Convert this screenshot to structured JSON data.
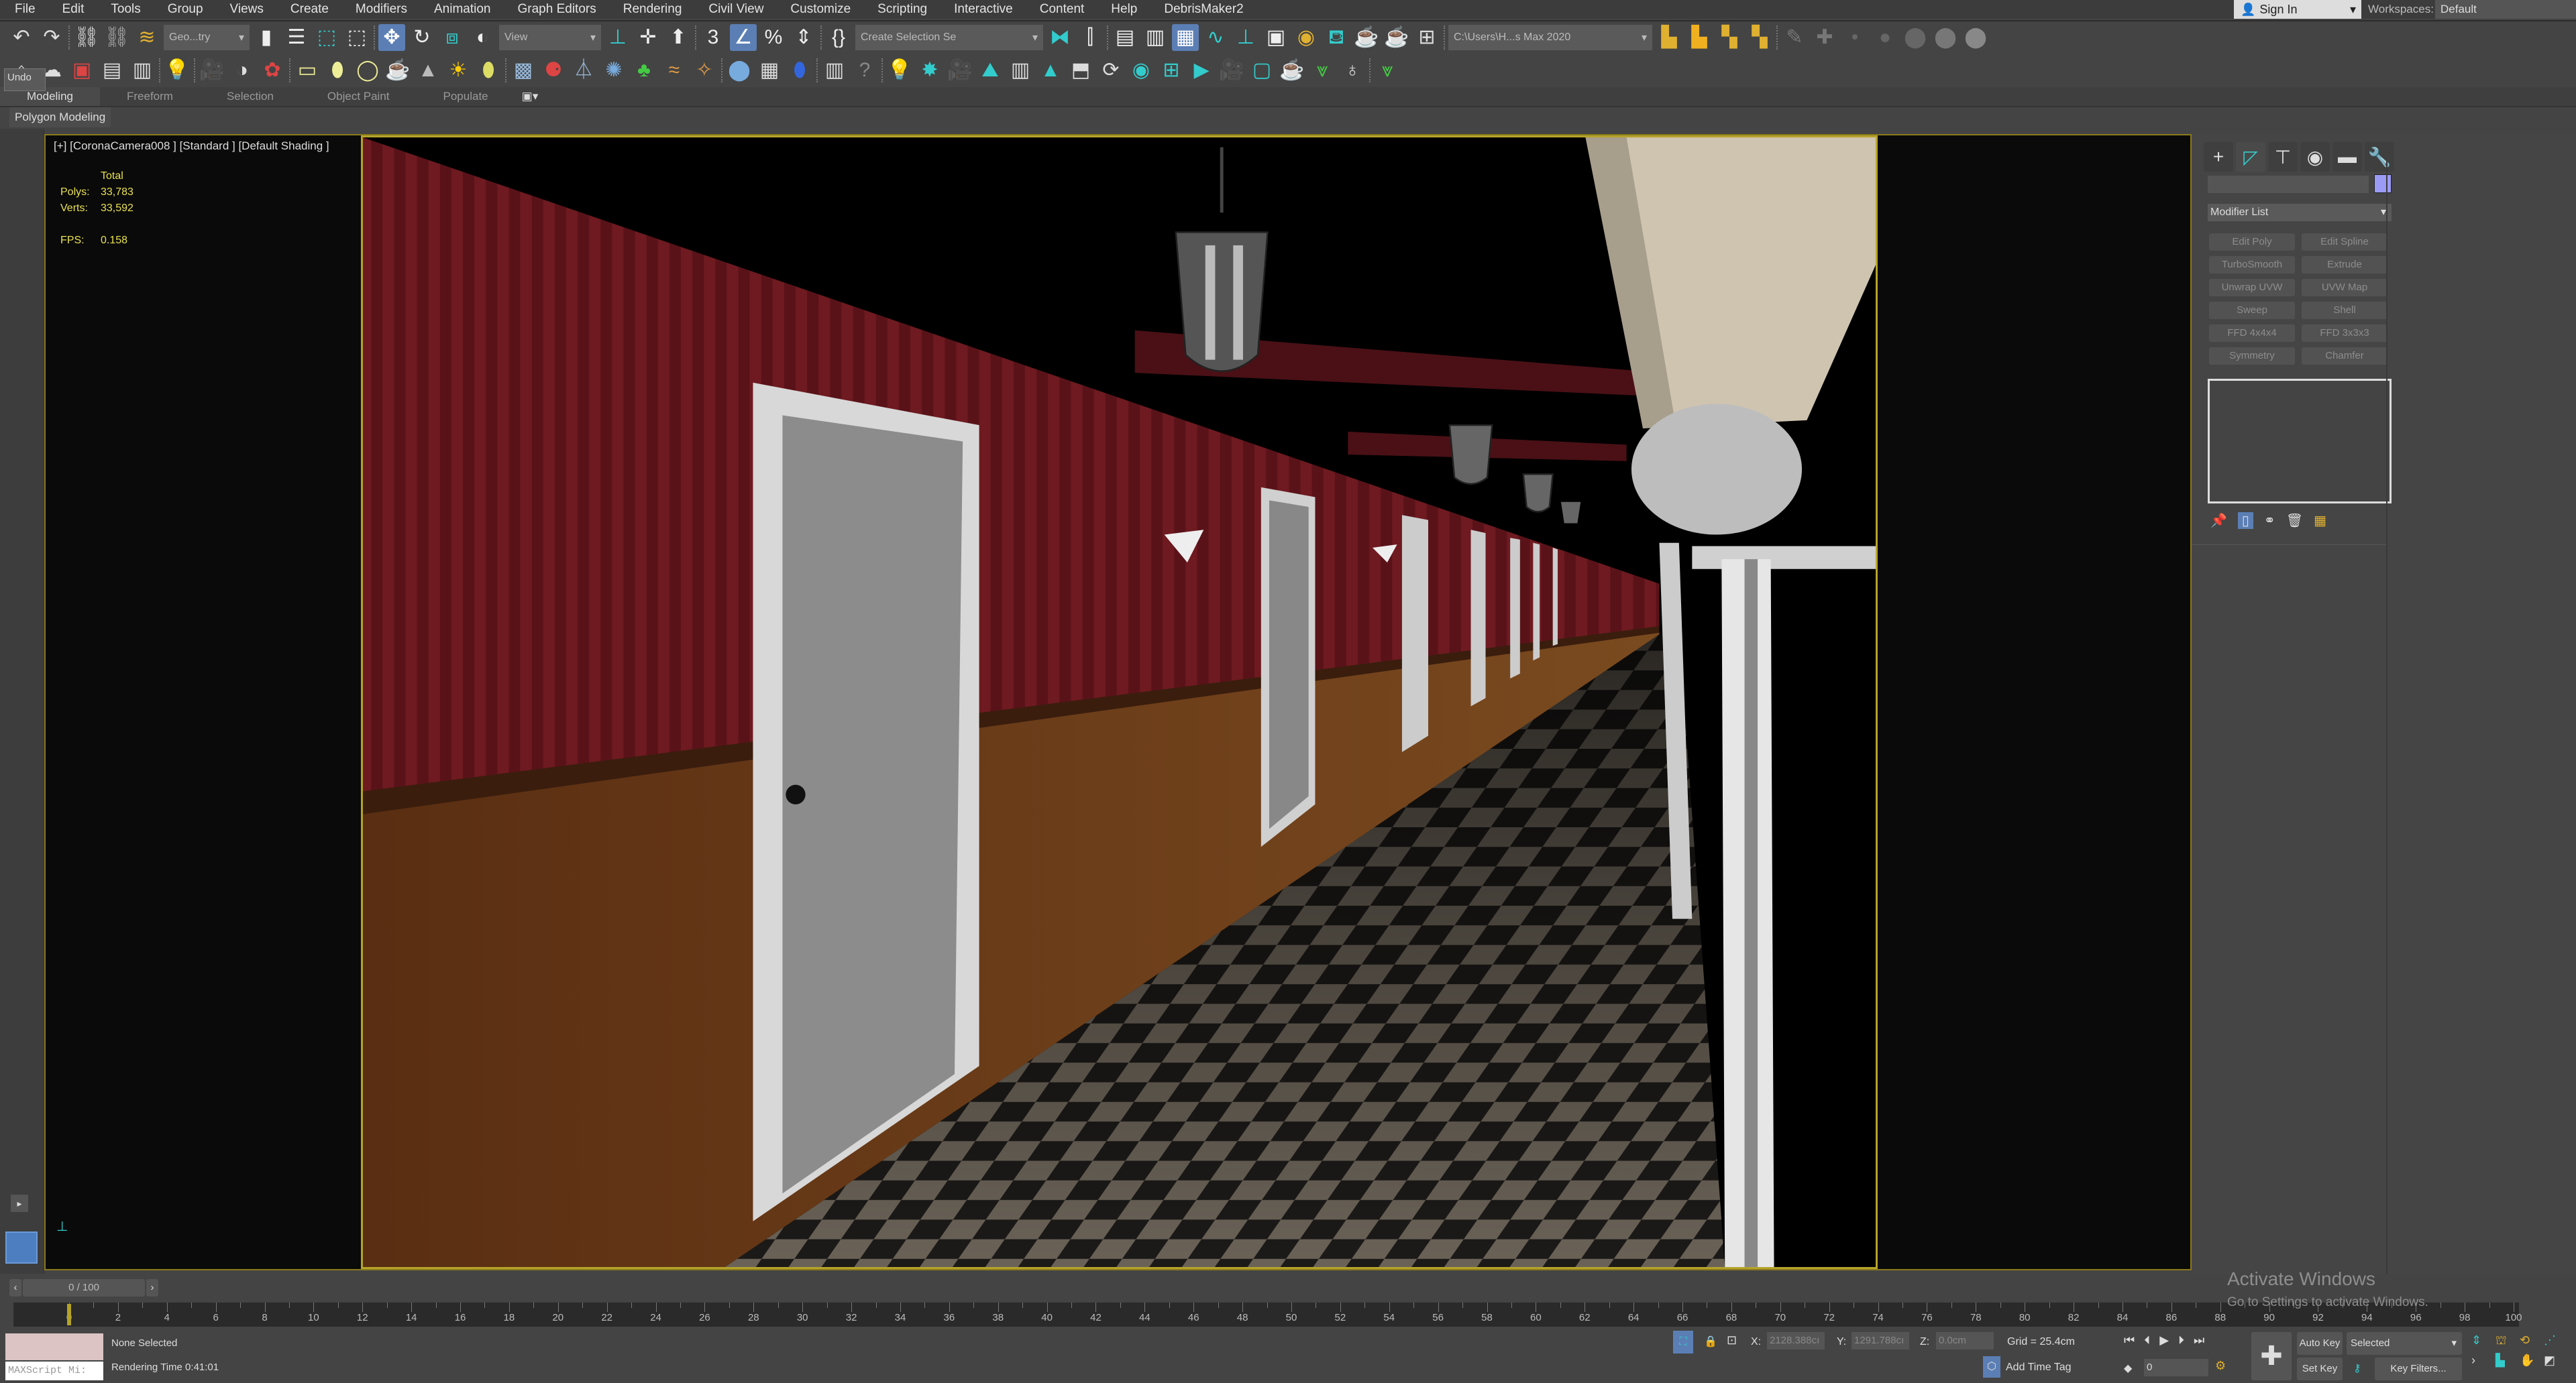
{
  "menu": [
    "File",
    "Edit",
    "Tools",
    "Group",
    "Views",
    "Create",
    "Modifiers",
    "Animation",
    "Graph Editors",
    "Rendering",
    "Civil View",
    "Customize",
    "Scripting",
    "Interactive",
    "Content",
    "Help",
    "DebrisMaker2"
  ],
  "account": {
    "sign_in": "Sign In",
    "workspaces_label": "Workspaces:",
    "workspace": "Default"
  },
  "toolbar1": [
    {
      "icon": "undo-icon",
      "glyph": "↶",
      "color": "#ddd"
    },
    {
      "icon": "redo-icon",
      "glyph": "↷",
      "color": "#ddd"
    },
    {
      "sep": true
    },
    {
      "icon": "link-icon",
      "glyph": "⛓",
      "color": "#ddd"
    },
    {
      "icon": "unlink-icon",
      "glyph": "⛓",
      "color": "#aaa"
    },
    {
      "icon": "bind-spacewarp-icon",
      "glyph": "≋",
      "color": "#e0b030"
    },
    {
      "dropdown": "Geo...try",
      "w": 80
    },
    {
      "icon": "select-object-icon",
      "glyph": "▮",
      "color": "#eee"
    },
    {
      "icon": "select-by-name-icon",
      "glyph": "☰",
      "color": "#eee"
    },
    {
      "icon": "rectangular-selection-icon",
      "glyph": "⬚",
      "color": "#3cc"
    },
    {
      "icon": "window-crossing-icon",
      "glyph": "⬚",
      "color": "#eee"
    },
    {
      "sep": true
    },
    {
      "icon": "move-icon",
      "glyph": "✥",
      "color": "#fff",
      "active": true
    },
    {
      "icon": "rotate-icon",
      "glyph": "↻",
      "color": "#eee"
    },
    {
      "icon": "scale-icon",
      "glyph": "⧈",
      "color": "#3cc"
    },
    {
      "icon": "place-icon",
      "glyph": "◐",
      "color": "#eee"
    },
    {
      "dropdown": "View",
      "w": 95
    },
    {
      "icon": "use-pivot-icon",
      "glyph": "⊥",
      "color": "#3cc"
    },
    {
      "icon": "select-manipulate-icon",
      "glyph": "✛",
      "color": "#eee"
    },
    {
      "icon": "keyboard-shortcut-icon",
      "glyph": "⬆",
      "color": "#eee"
    },
    {
      "sep": true
    },
    {
      "icon": "snaps-toggle-icon",
      "glyph": "3",
      "color": "#eee"
    },
    {
      "icon": "angle-snap-icon",
      "glyph": "∠",
      "color": "#fff",
      "active": true
    },
    {
      "icon": "percent-snap-icon",
      "glyph": "%",
      "color": "#eee"
    },
    {
      "icon": "spinner-snap-icon",
      "glyph": "⇕",
      "color": "#eee"
    },
    {
      "sep": true
    },
    {
      "icon": "edit-named-selection-icon",
      "glyph": "{}",
      "color": "#eee"
    },
    {
      "dropdown": "Create Selection Se",
      "w": 175
    },
    {
      "icon": "mirror-icon",
      "glyph": "⧓",
      "color": "#3cc"
    },
    {
      "icon": "align-icon",
      "glyph": "⫿",
      "color": "#eee"
    },
    {
      "sep": true
    },
    {
      "icon": "scene-explorer-icon",
      "glyph": "▤",
      "color": "#eee"
    },
    {
      "icon": "layer-explorer-icon",
      "glyph": "▥",
      "color": "#eee"
    },
    {
      "icon": "toggle-ribbon-icon",
      "glyph": "▦",
      "color": "#fff",
      "active": true
    },
    {
      "icon": "curve-editor-icon",
      "glyph": "∿",
      "color": "#3cc"
    },
    {
      "icon": "dope-sheet-icon",
      "glyph": "⊥",
      "color": "#3cc"
    },
    {
      "icon": "schematic-view-icon",
      "glyph": "▣",
      "color": "#eee"
    },
    {
      "icon": "material-editor-icon",
      "glyph": "◉",
      "color": "#e0b030"
    },
    {
      "icon": "render-setup-icon",
      "glyph": "⛾",
      "color": "#3cc"
    },
    {
      "icon": "rendered-frame-window-icon",
      "glyph": "☕",
      "color": "#ddd"
    },
    {
      "icon": "render-production-icon",
      "glyph": "☕",
      "color": "#3cc"
    },
    {
      "icon": "render-layout-icon",
      "glyph": "⊞",
      "color": "#ddd"
    },
    {
      "sep": true
    },
    {
      "dropdown": "C:\\Users\\H...s Max 2020",
      "w": 190
    },
    {
      "icon": "project-folder-icon",
      "glyph": "▙",
      "color": "#e0b030"
    },
    {
      "icon": "open-project-icon",
      "glyph": "▙",
      "color": "#f0b020"
    },
    {
      "icon": "project-tree-icon",
      "glyph": "▚",
      "color": "#e0b030"
    },
    {
      "icon": "project-settings-icon",
      "glyph": "▚",
      "color": "#e0b030"
    },
    {
      "sep": true
    },
    {
      "icon": "pen-tool-icon",
      "glyph": "✎",
      "color": "#777"
    },
    {
      "icon": "add-point-icon",
      "glyph": "✚",
      "color": "#777"
    },
    {
      "icon": "brush-size-1-icon",
      "glyph": "•",
      "color": "#666"
    },
    {
      "icon": "brush-size-2-icon",
      "glyph": "●",
      "color": "#666"
    },
    {
      "icon": "brush-size-3-icon",
      "glyph": "⬤",
      "color": "#666"
    },
    {
      "icon": "brush-size-4-icon",
      "glyph": "⬤",
      "color": "#777"
    },
    {
      "icon": "brush-size-5-icon",
      "glyph": "⬤",
      "color": "#888"
    }
  ],
  "toolbar2": [
    {
      "icon": "plane-icon",
      "glyph": "⌂",
      "color": "#ddd"
    },
    {
      "icon": "cloud-icon",
      "glyph": "☁",
      "color": "#ddd"
    },
    {
      "icon": "render-frame-icon",
      "glyph": "▣",
      "color": "#d44"
    },
    {
      "icon": "panel-icon",
      "glyph": "▤",
      "color": "#ddd"
    },
    {
      "icon": "panel-2-icon",
      "glyph": "▥",
      "color": "#ddd"
    },
    {
      "sep": true
    },
    {
      "icon": "light-lister-icon",
      "glyph": "💡",
      "color": "#ee8"
    },
    {
      "sep": true
    },
    {
      "icon": "camera-icon",
      "glyph": "🎥",
      "color": "#ddd"
    },
    {
      "icon": "corona-camera-icon",
      "glyph": "◑",
      "color": "#ddd"
    },
    {
      "icon": "corona-converter-icon",
      "glyph": "✿",
      "color": "#d44"
    },
    {
      "sep": true
    },
    {
      "icon": "corona-light-rect-icon",
      "glyph": "▭",
      "color": "#ee9"
    },
    {
      "icon": "corona-light-sphere-icon",
      "glyph": "⬮",
      "color": "#ee9"
    },
    {
      "icon": "corona-light-disk-icon",
      "glyph": "◯",
      "color": "#ee9"
    },
    {
      "icon": "corona-teapot-icon",
      "glyph": "☕",
      "color": "#bbb"
    },
    {
      "icon": "corona-cone-icon",
      "glyph": "▲",
      "color": "#bbb"
    },
    {
      "icon": "corona-sun-icon",
      "glyph": "☀",
      "color": "#fc0"
    },
    {
      "icon": "corona-sky-icon",
      "glyph": "⬮",
      "color": "#dd6"
    },
    {
      "sep": true
    },
    {
      "icon": "corona-scatter-icon",
      "glyph": "▩",
      "color": "#9bd"
    },
    {
      "icon": "corona-proxy-icon",
      "glyph": "⚈",
      "color": "#d44"
    },
    {
      "icon": "corona-slicer-icon",
      "glyph": "⏃",
      "color": "#9bd"
    },
    {
      "icon": "corona-displacement-icon",
      "glyph": "✺",
      "color": "#7ad"
    },
    {
      "icon": "corona-grass-icon",
      "glyph": "♣",
      "color": "#4c4"
    },
    {
      "icon": "corona-hair-icon",
      "glyph": "≈",
      "color": "#d94"
    },
    {
      "icon": "corona-fur-icon",
      "glyph": "✧",
      "color": "#d94"
    },
    {
      "sep": true
    },
    {
      "icon": "corona-material-icon",
      "glyph": "⬤",
      "color": "#7ad"
    },
    {
      "icon": "corona-map-icon",
      "glyph": "▦",
      "color": "#ddd"
    },
    {
      "icon": "corona-vfb-icon",
      "glyph": "⬮",
      "color": "#36d"
    },
    {
      "sep": true
    },
    {
      "icon": "corona-settings-icon",
      "glyph": "▥",
      "color": "#ddd"
    },
    {
      "icon": "help-icon",
      "glyph": "?",
      "color": "#888"
    },
    {
      "sep": true
    },
    {
      "icon": "tool-a-icon",
      "glyph": "💡",
      "color": "#3cc"
    },
    {
      "icon": "tool-b-icon",
      "glyph": "✸",
      "color": "#3cc"
    },
    {
      "icon": "tool-c-icon",
      "glyph": "🎥",
      "color": "#3cc"
    },
    {
      "icon": "tool-d-icon",
      "glyph": "⛰",
      "color": "#3cc"
    },
    {
      "icon": "tool-e-icon",
      "glyph": "▥",
      "color": "#ddd"
    },
    {
      "icon": "tool-f-icon",
      "glyph": "▲",
      "color": "#3cc"
    },
    {
      "icon": "tool-g-icon",
      "glyph": "⬒",
      "color": "#ddd"
    },
    {
      "icon": "tool-h-icon",
      "glyph": "⟳",
      "color": "#ddd"
    },
    {
      "icon": "tool-i-icon",
      "glyph": "◉",
      "color": "#3cc"
    },
    {
      "icon": "tool-j-icon",
      "glyph": "⊞",
      "color": "#3cc"
    },
    {
      "icon": "tool-k-icon",
      "glyph": "▶",
      "color": "#3cc"
    },
    {
      "icon": "tool-l-icon",
      "glyph": "🎥",
      "color": "#ddd"
    },
    {
      "icon": "tool-m-icon",
      "glyph": "▢",
      "color": "#3cc"
    },
    {
      "icon": "tool-n-icon",
      "glyph": "☕",
      "color": "#ddd"
    },
    {
      "icon": "double-chevron-icon",
      "glyph": "⩔",
      "color": "#4c4"
    },
    {
      "icon": "bulb-icon",
      "glyph": "♁",
      "color": "#ddd"
    },
    {
      "sep": true
    },
    {
      "icon": "double-chevron-2-icon",
      "glyph": "⩔",
      "color": "#4c4"
    }
  ],
  "ribbon": {
    "tabs": [
      "Modeling",
      "Freeform",
      "Selection",
      "Object Paint",
      "Populate"
    ],
    "active": 0,
    "panel": "Polygon Modeling"
  },
  "tooltip": "Undo",
  "viewport": {
    "label": "[+] [CoronaCamera008 ] [Standard ] [Default Shading ]",
    "stats_header": "Total",
    "polys_label": "Polys:",
    "polys": "33,783",
    "verts_label": "Verts:",
    "verts": "33,592",
    "fps_label": "FPS:",
    "fps": "0.158"
  },
  "command_panel": {
    "tabs": [
      {
        "icon": "create-icon",
        "glyph": "+"
      },
      {
        "icon": "modify-icon",
        "glyph": "◸"
      },
      {
        "icon": "hierarchy-icon",
        "glyph": "⊤"
      },
      {
        "icon": "motion-icon",
        "glyph": "◉"
      },
      {
        "icon": "display-icon",
        "glyph": "▬"
      },
      {
        "icon": "utilities-icon",
        "glyph": "🔧"
      }
    ],
    "object_color": "#9b9bf5",
    "modifier_list": "Modifier List",
    "modifiers": [
      "Edit Poly",
      "Edit Spline",
      "TurboSmooth",
      "Extrude",
      "Unwrap UVW",
      "UVW Map",
      "Sweep",
      "Shell",
      "FFD 4x4x4",
      "FFD 3x3x3",
      "Symmetry",
      "Chamfer"
    ]
  },
  "timeline": {
    "current": 0,
    "end": 100,
    "slider_label": "0 / 100",
    "tick_step": 2
  },
  "status": {
    "selection": "None Selected",
    "render_time": "Rendering Time  0:41:01",
    "maxscript": "MAXScript Mi:",
    "x_label": "X:",
    "x": "2128.388cı",
    "y_label": "Y:",
    "y": "1291.788cı",
    "z_label": "Z:",
    "z": "0.0cm",
    "grid": "Grid = 25.4cm",
    "add_time_tag": "Add Time Tag",
    "auto_key": "Auto Key",
    "set_key": "Set Key",
    "key_mode": "Selected",
    "key_filters": "Key Filters...",
    "frame": "0"
  },
  "watermark": {
    "title": "Activate Windows",
    "subtitle": "Go to Settings to activate Windows."
  }
}
